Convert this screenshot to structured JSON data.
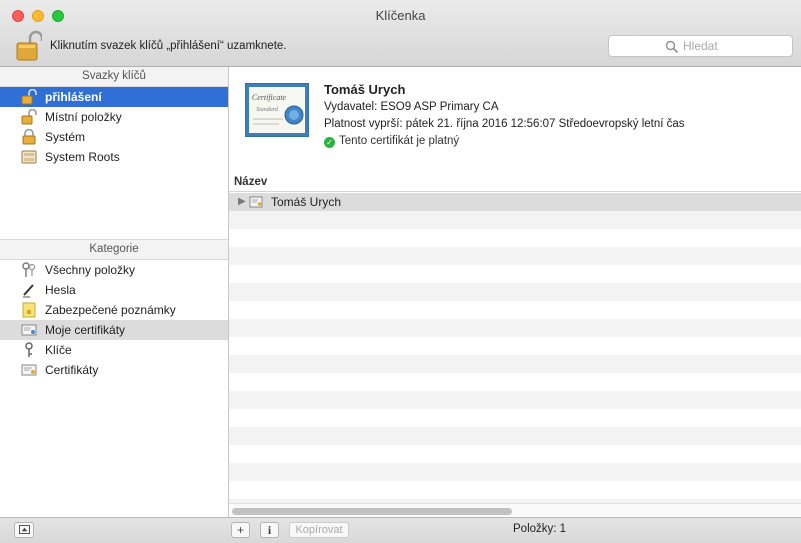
{
  "window": {
    "title": "Klíčenka"
  },
  "toolbar": {
    "lock_hint": "Kliknutím svazek klíčů „přihlášení“ uzamknete.",
    "search_placeholder": "Hledat"
  },
  "sidebar": {
    "keychains_header": "Svazky klíčů",
    "keychains": [
      {
        "label": "přihlášení",
        "icon": "unlocked-padlock-icon",
        "selected": true
      },
      {
        "label": "Místní položky",
        "icon": "unlocked-padlock-icon"
      },
      {
        "label": "Systém",
        "icon": "padlock-icon"
      },
      {
        "label": "System Roots",
        "icon": "cabinet-icon"
      }
    ],
    "categories_header": "Kategorie",
    "categories": [
      {
        "label": "Všechny položky",
        "icon": "keys-icon"
      },
      {
        "label": "Hesla",
        "icon": "pen-icon"
      },
      {
        "label": "Zabezpečené poznámky",
        "icon": "note-icon"
      },
      {
        "label": "Moje certifikáty",
        "icon": "my-certificate-icon",
        "selected": true
      },
      {
        "label": "Klíče",
        "icon": "key-icon"
      },
      {
        "label": "Certifikáty",
        "icon": "certificate-icon"
      }
    ]
  },
  "certificate": {
    "name": "Tomáš Urych",
    "issuer": "Vydavatel: ESO9 ASP Primary CA",
    "expiry": "Platnost vyprší: pátek 21. října 2016 12:56:07 Středoevropský letní čas",
    "status": "Tento certifikát je platný",
    "badge_line1": "Certificate",
    "badge_line2": "Standard"
  },
  "table": {
    "column_name": "Název",
    "rows": [
      {
        "name": "Tomáš Urych"
      }
    ]
  },
  "bottom": {
    "add": "+",
    "info": "i",
    "copy": "Kopírovat",
    "count": "Položky: 1"
  }
}
